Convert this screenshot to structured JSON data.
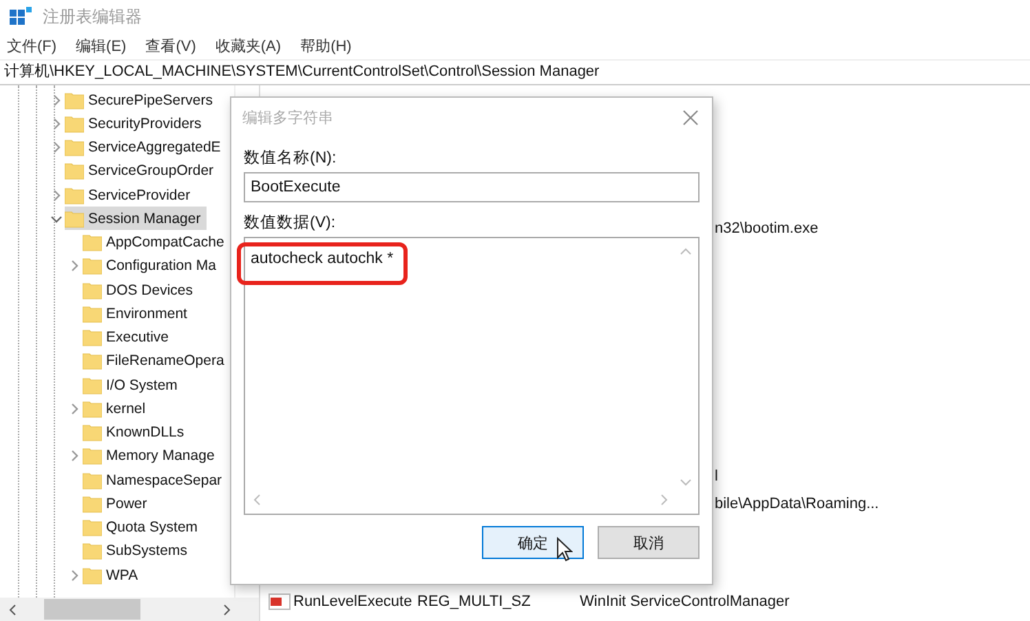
{
  "window": {
    "title": "注册表编辑器"
  },
  "menu": [
    "文件(F)",
    "编辑(E)",
    "查看(V)",
    "收藏夹(A)",
    "帮助(H)"
  ],
  "address": "计算机\\HKEY_LOCAL_MACHINE\\SYSTEM\\CurrentControlSet\\Control\\Session Manager",
  "tree": [
    {
      "label": "SecurePipeServers",
      "expanded": false,
      "selected": false
    },
    {
      "label": "SecurityProviders",
      "expanded": false,
      "selected": false
    },
    {
      "label": "ServiceAggregatedE",
      "expanded": false,
      "selected": false
    },
    {
      "label": "ServiceGroupOrder",
      "selected": false
    },
    {
      "label": "ServiceProvider",
      "expanded": false,
      "selected": false
    },
    {
      "label": "Session Manager",
      "expanded": true,
      "selected": true,
      "children": [
        {
          "label": "AppCompatCache",
          "selected": false
        },
        {
          "label": "Configuration Ma",
          "expanded": false,
          "selected": false
        },
        {
          "label": "DOS Devices",
          "selected": false
        },
        {
          "label": "Environment",
          "selected": false
        },
        {
          "label": "Executive",
          "selected": false
        },
        {
          "label": "FileRenameOpera",
          "selected": false
        },
        {
          "label": "I/O System",
          "selected": false
        },
        {
          "label": "kernel",
          "expanded": false,
          "selected": false
        },
        {
          "label": "KnownDLLs",
          "selected": false
        },
        {
          "label": "Memory Manage",
          "expanded": false,
          "selected": false
        },
        {
          "label": "NamespaceSepar",
          "selected": false
        },
        {
          "label": "Power",
          "selected": false
        },
        {
          "label": "Quota System",
          "selected": false
        },
        {
          "label": "SubSystems",
          "selected": false
        },
        {
          "label": "WPA",
          "expanded": false,
          "selected": false
        }
      ]
    }
  ],
  "values": [
    {
      "kind": "partial",
      "data": "n32\\bootim.exe"
    },
    {
      "kind": "partial",
      "data": "l"
    },
    {
      "kind": "partial",
      "data": "bile\\AppData\\Roaming..."
    },
    {
      "kind": "full",
      "name": "RunLevelExecute",
      "type": "REG_MULTI_SZ",
      "data": "WinInit ServiceControlManager"
    }
  ],
  "dialog": {
    "title": "编辑多字符串",
    "name_label": "数值名称(N):",
    "name_value": "BootExecute",
    "data_label": "数值数据(V):",
    "data_value": "autocheck autochk *",
    "buttons": [
      {
        "label": "确定",
        "focused": true
      },
      {
        "label": "取消",
        "focused": false
      }
    ]
  }
}
